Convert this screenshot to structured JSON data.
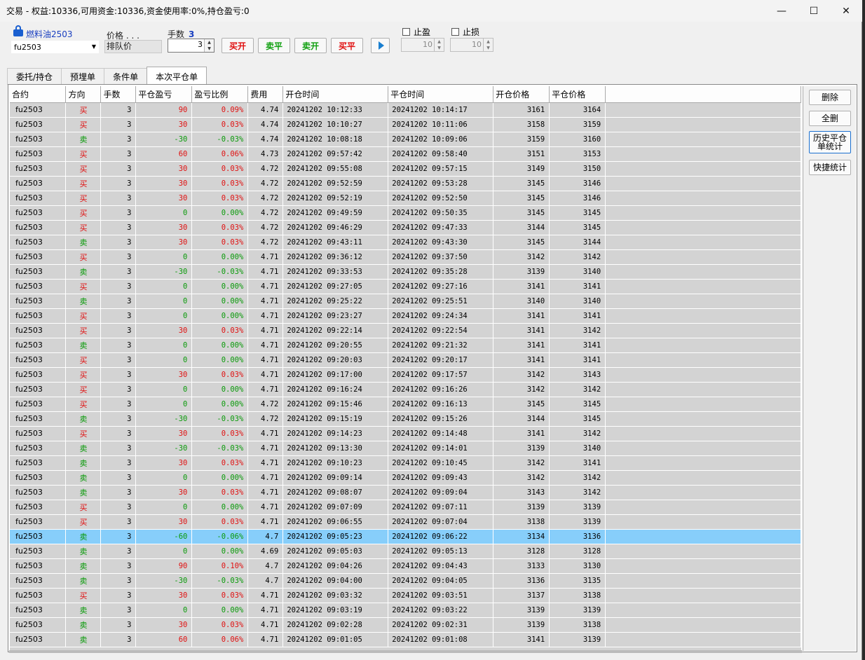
{
  "window": {
    "title": "交易 - 权益:10336,可用资金:10336,资金使用率:0%,持仓盈亏:0",
    "controls": {
      "minimize": "—",
      "maximize": "☐",
      "close": "✕"
    }
  },
  "toolbar": {
    "instrument_name": "燃料油2503",
    "instrument_code": "fu2503",
    "price_label": "价格 . . .",
    "price_mode": "排队价",
    "qty_label": "手数",
    "qty_value_display": "3",
    "qty_input": "3",
    "buy_open": "买开",
    "sell_close": "卖平",
    "sell_open": "卖开",
    "buy_close": "买平",
    "take_profit_label": "止盈",
    "stop_loss_label": "止损",
    "take_profit_value": "10",
    "stop_loss_value": "10"
  },
  "tabs": [
    "委托/持仓",
    "预埋单",
    "条件单",
    "本次平仓单"
  ],
  "active_tab": "本次平仓单",
  "side_buttons": {
    "delete": "删除",
    "delete_all": "全删",
    "history_stats": "历史平仓单统计",
    "quick_stats": "快捷统计"
  },
  "columns": [
    "合约",
    "方向",
    "手数",
    "平仓盈亏",
    "盈亏比例",
    "费用",
    "开仓时间",
    "平仓时间",
    "开仓价格",
    "平仓价格"
  ],
  "rows": [
    [
      "fu2503",
      "买",
      "3",
      "90",
      "0.09%",
      "4.74",
      "20241202  10:12:33",
      "20241202  10:14:17",
      "3161",
      "3164"
    ],
    [
      "fu2503",
      "买",
      "3",
      "30",
      "0.03%",
      "4.74",
      "20241202  10:10:27",
      "20241202  10:11:06",
      "3158",
      "3159"
    ],
    [
      "fu2503",
      "卖",
      "3",
      "-30",
      "-0.03%",
      "4.74",
      "20241202  10:08:18",
      "20241202  10:09:06",
      "3159",
      "3160"
    ],
    [
      "fu2503",
      "买",
      "3",
      "60",
      "0.06%",
      "4.73",
      "20241202  09:57:42",
      "20241202  09:58:40",
      "3151",
      "3153"
    ],
    [
      "fu2503",
      "买",
      "3",
      "30",
      "0.03%",
      "4.72",
      "20241202  09:55:08",
      "20241202  09:57:15",
      "3149",
      "3150"
    ],
    [
      "fu2503",
      "买",
      "3",
      "30",
      "0.03%",
      "4.72",
      "20241202  09:52:59",
      "20241202  09:53:28",
      "3145",
      "3146"
    ],
    [
      "fu2503",
      "买",
      "3",
      "30",
      "0.03%",
      "4.72",
      "20241202  09:52:19",
      "20241202  09:52:50",
      "3145",
      "3146"
    ],
    [
      "fu2503",
      "买",
      "3",
      "0",
      "0.00%",
      "4.72",
      "20241202  09:49:59",
      "20241202  09:50:35",
      "3145",
      "3145"
    ],
    [
      "fu2503",
      "买",
      "3",
      "30",
      "0.03%",
      "4.72",
      "20241202  09:46:29",
      "20241202  09:47:33",
      "3144",
      "3145"
    ],
    [
      "fu2503",
      "卖",
      "3",
      "30",
      "0.03%",
      "4.72",
      "20241202  09:43:11",
      "20241202  09:43:30",
      "3145",
      "3144"
    ],
    [
      "fu2503",
      "买",
      "3",
      "0",
      "0.00%",
      "4.71",
      "20241202  09:36:12",
      "20241202  09:37:50",
      "3142",
      "3142"
    ],
    [
      "fu2503",
      "卖",
      "3",
      "-30",
      "-0.03%",
      "4.71",
      "20241202  09:33:53",
      "20241202  09:35:28",
      "3139",
      "3140"
    ],
    [
      "fu2503",
      "买",
      "3",
      "0",
      "0.00%",
      "4.71",
      "20241202  09:27:05",
      "20241202  09:27:16",
      "3141",
      "3141"
    ],
    [
      "fu2503",
      "卖",
      "3",
      "0",
      "0.00%",
      "4.71",
      "20241202  09:25:22",
      "20241202  09:25:51",
      "3140",
      "3140"
    ],
    [
      "fu2503",
      "买",
      "3",
      "0",
      "0.00%",
      "4.71",
      "20241202  09:23:27",
      "20241202  09:24:34",
      "3141",
      "3141"
    ],
    [
      "fu2503",
      "买",
      "3",
      "30",
      "0.03%",
      "4.71",
      "20241202  09:22:14",
      "20241202  09:22:54",
      "3141",
      "3142"
    ],
    [
      "fu2503",
      "卖",
      "3",
      "0",
      "0.00%",
      "4.71",
      "20241202  09:20:55",
      "20241202  09:21:32",
      "3141",
      "3141"
    ],
    [
      "fu2503",
      "买",
      "3",
      "0",
      "0.00%",
      "4.71",
      "20241202  09:20:03",
      "20241202  09:20:17",
      "3141",
      "3141"
    ],
    [
      "fu2503",
      "买",
      "3",
      "30",
      "0.03%",
      "4.71",
      "20241202  09:17:00",
      "20241202  09:17:57",
      "3142",
      "3143"
    ],
    [
      "fu2503",
      "买",
      "3",
      "0",
      "0.00%",
      "4.71",
      "20241202  09:16:24",
      "20241202  09:16:26",
      "3142",
      "3142"
    ],
    [
      "fu2503",
      "买",
      "3",
      "0",
      "0.00%",
      "4.72",
      "20241202  09:15:46",
      "20241202  09:16:13",
      "3145",
      "3145"
    ],
    [
      "fu2503",
      "卖",
      "3",
      "-30",
      "-0.03%",
      "4.72",
      "20241202  09:15:19",
      "20241202  09:15:26",
      "3144",
      "3145"
    ],
    [
      "fu2503",
      "买",
      "3",
      "30",
      "0.03%",
      "4.71",
      "20241202  09:14:23",
      "20241202  09:14:48",
      "3141",
      "3142"
    ],
    [
      "fu2503",
      "卖",
      "3",
      "-30",
      "-0.03%",
      "4.71",
      "20241202  09:13:30",
      "20241202  09:14:01",
      "3139",
      "3140"
    ],
    [
      "fu2503",
      "卖",
      "3",
      "30",
      "0.03%",
      "4.71",
      "20241202  09:10:23",
      "20241202  09:10:45",
      "3142",
      "3141"
    ],
    [
      "fu2503",
      "卖",
      "3",
      "0",
      "0.00%",
      "4.71",
      "20241202  09:09:14",
      "20241202  09:09:43",
      "3142",
      "3142"
    ],
    [
      "fu2503",
      "卖",
      "3",
      "30",
      "0.03%",
      "4.71",
      "20241202  09:08:07",
      "20241202  09:09:04",
      "3143",
      "3142"
    ],
    [
      "fu2503",
      "买",
      "3",
      "0",
      "0.00%",
      "4.71",
      "20241202  09:07:09",
      "20241202  09:07:11",
      "3139",
      "3139"
    ],
    [
      "fu2503",
      "买",
      "3",
      "30",
      "0.03%",
      "4.71",
      "20241202  09:06:55",
      "20241202  09:07:04",
      "3138",
      "3139"
    ],
    [
      "fu2503",
      "卖",
      "3",
      "-60",
      "-0.06%",
      "4.7",
      "20241202  09:05:23",
      "20241202  09:06:22",
      "3134",
      "3136"
    ],
    [
      "fu2503",
      "卖",
      "3",
      "0",
      "0.00%",
      "4.69",
      "20241202  09:05:03",
      "20241202  09:05:13",
      "3128",
      "3128"
    ],
    [
      "fu2503",
      "卖",
      "3",
      "90",
      "0.10%",
      "4.7",
      "20241202  09:04:26",
      "20241202  09:04:43",
      "3133",
      "3130"
    ],
    [
      "fu2503",
      "卖",
      "3",
      "-30",
      "-0.03%",
      "4.7",
      "20241202  09:04:00",
      "20241202  09:04:05",
      "3136",
      "3135"
    ],
    [
      "fu2503",
      "买",
      "3",
      "30",
      "0.03%",
      "4.71",
      "20241202  09:03:32",
      "20241202  09:03:51",
      "3137",
      "3138"
    ],
    [
      "fu2503",
      "卖",
      "3",
      "0",
      "0.00%",
      "4.71",
      "20241202  09:03:19",
      "20241202  09:03:22",
      "3139",
      "3139"
    ],
    [
      "fu2503",
      "卖",
      "3",
      "30",
      "0.03%",
      "4.71",
      "20241202  09:02:28",
      "20241202  09:02:31",
      "3139",
      "3138"
    ],
    [
      "fu2503",
      "卖",
      "3",
      "60",
      "0.06%",
      "4.71",
      "20241202  09:01:05",
      "20241202  09:01:08",
      "3141",
      "3139"
    ]
  ],
  "selected_row_index": 29,
  "colors": {
    "buy": "#e01010",
    "sell": "#0a9a0a",
    "row_bg": "#d3d3d3",
    "selected_bg": "#87cefa"
  }
}
